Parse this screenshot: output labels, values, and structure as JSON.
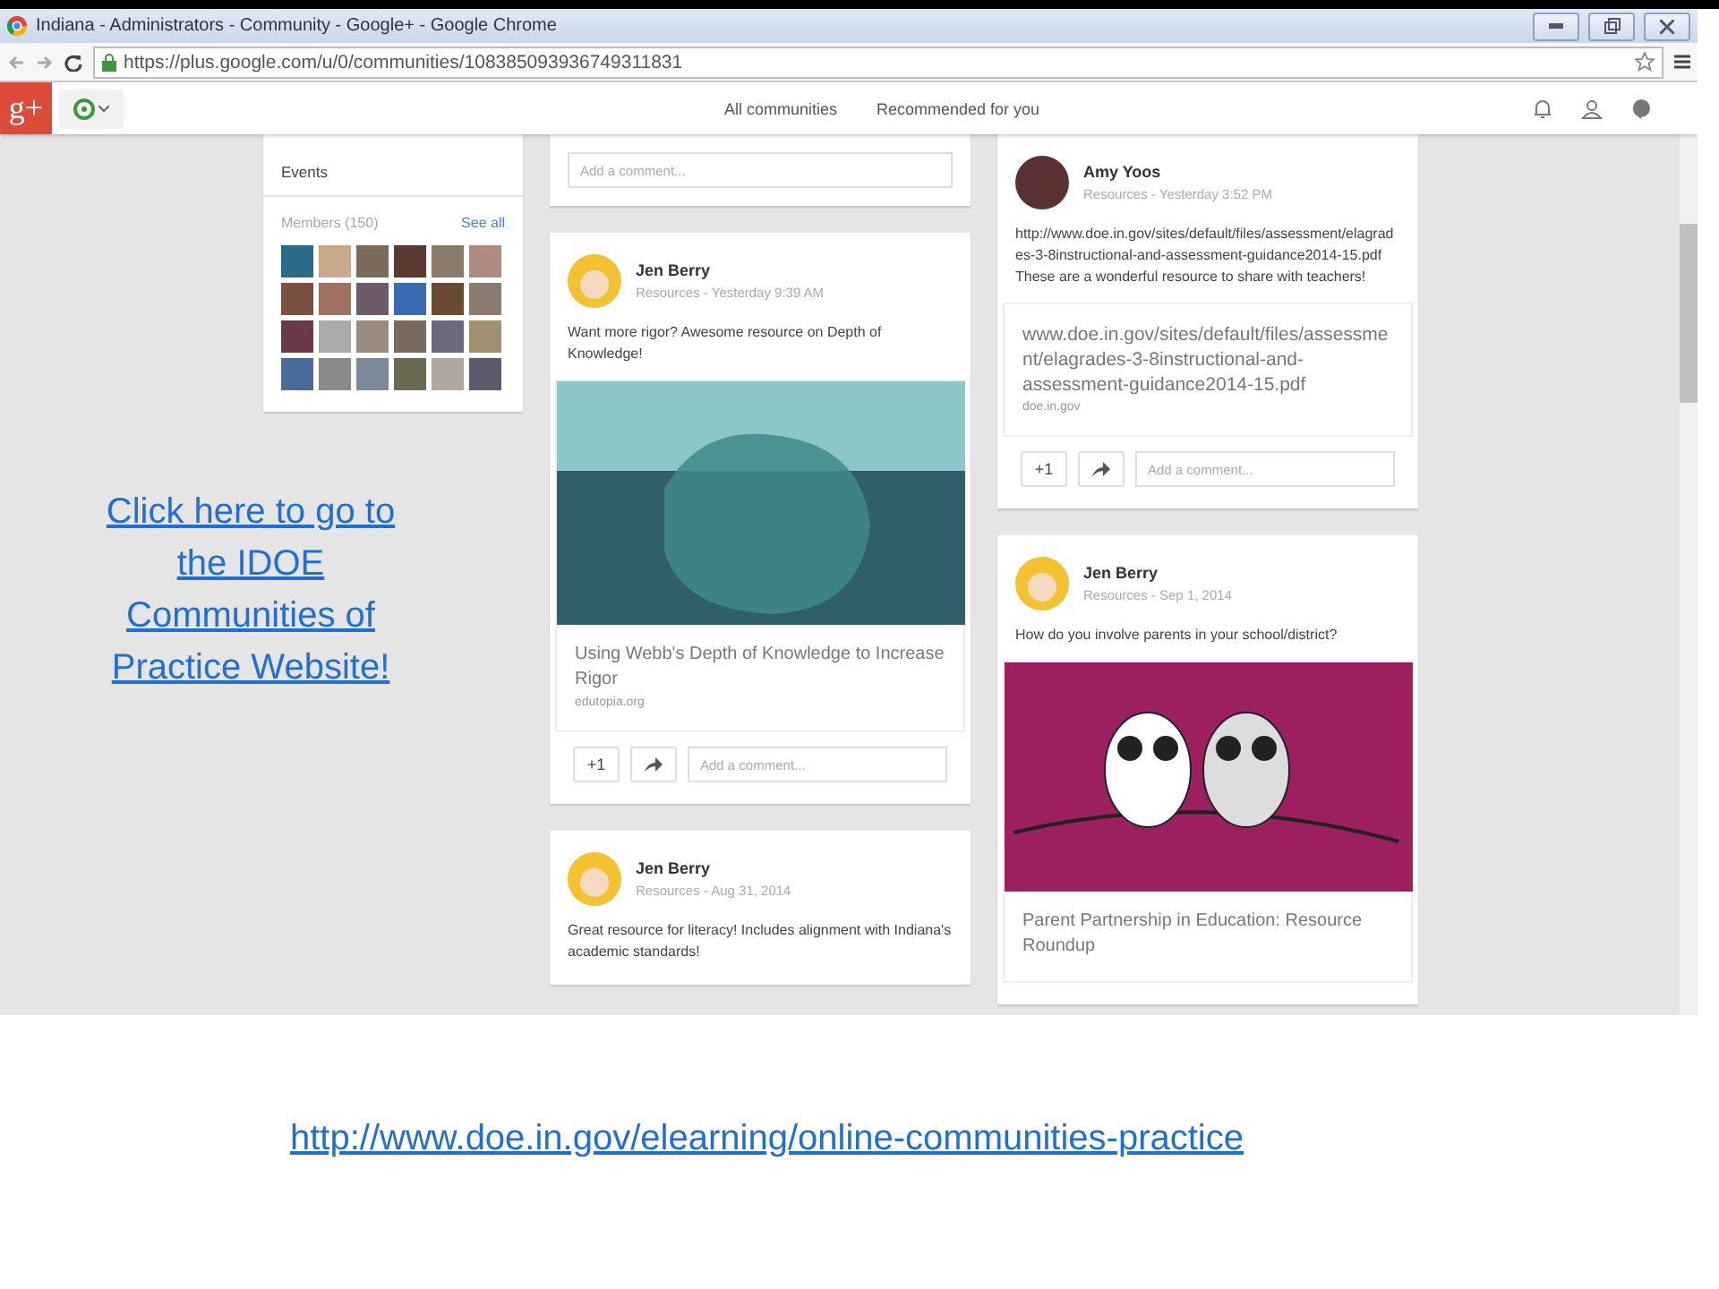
{
  "browser": {
    "title": "Indiana - Administrators - Community - Google+ - Google Chrome",
    "url": "https://plus.google.com/u/0/communities/108385093936749311831"
  },
  "nav": {
    "logo": "g+",
    "links": [
      "All communities",
      "Recommended for you"
    ]
  },
  "sidebar": {
    "events": "Events",
    "members_label": "Members (150)",
    "see_all": "See all"
  },
  "slide_link_left": "Click here to go to the IDOE Communities of Practice Website!",
  "columns": [
    [
      {
        "kind": "comment_only",
        "comment_placeholder": "Add a comment..."
      },
      {
        "kind": "post",
        "author": "Jen Berry",
        "meta": "Resources - Yesterday 9:39 AM",
        "text": "Want more rigor? Awesome resource on Depth of Knowledge!",
        "preview": {
          "kind": "iceberg",
          "title": "Using Webb's Depth of Knowledge to Increase Rigor",
          "site": "edutopia.org"
        },
        "plus_one": "+1",
        "comment_placeholder": "Add a comment..."
      },
      {
        "kind": "post",
        "author": "Jen Berry",
        "meta": "Resources - Aug 31, 2014",
        "text": "Great resource for literacy! Includes alignment with Indiana's academic standards!"
      }
    ],
    [
      {
        "kind": "post",
        "author": "Amy Yoos",
        "meta": "Resources - Yesterday 3:52 PM",
        "text": "http://www.doe.in.gov/sites/default/files/assessment/elagrades-3-8instructional-and-assessment-guidance2014-15.pdf\nThese are a wonderful resource to share with teachers!",
        "preview": {
          "title": "www.doe.in.gov/sites/default/files/assessment/elagrades-3-8instructional-and-assessment-guidance2014-15.pdf",
          "site": "doe.in.gov"
        },
        "plus_one": "+1",
        "comment_placeholder": "Add a comment..."
      },
      {
        "kind": "post",
        "author": "Jen Berry",
        "meta": "Resources - Sep 1, 2014",
        "text": "How do you involve parents in your school/district?",
        "preview": {
          "kind": "owls",
          "title": "Parent Partnership in Education: Resource Roundup"
        }
      }
    ]
  ],
  "footer_link": "http://www.doe.in.gov/elearning/online-communities-practice"
}
